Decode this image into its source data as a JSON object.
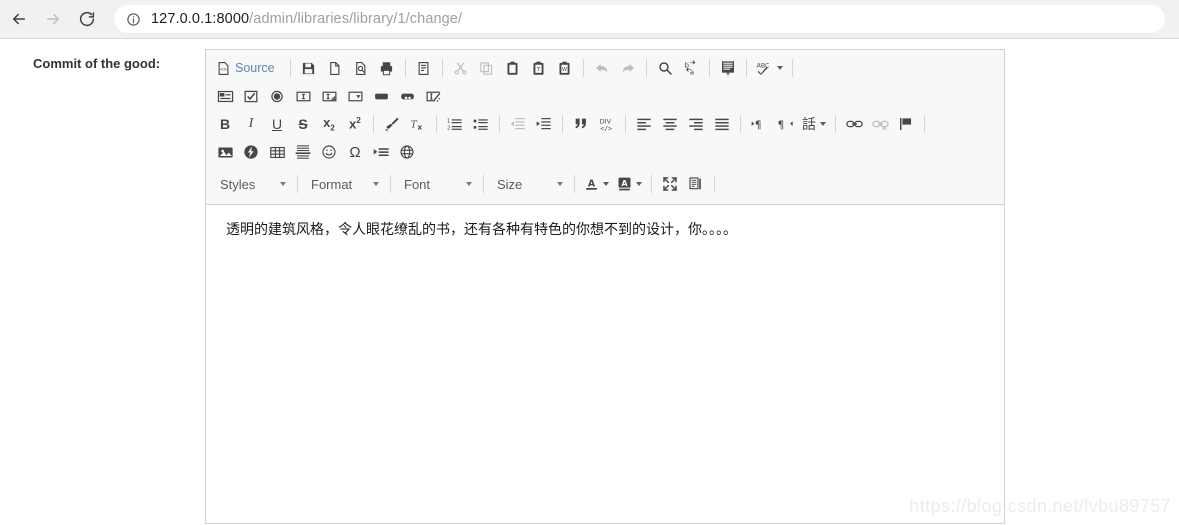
{
  "browser": {
    "back_icon": "back-arrow-icon",
    "forward_icon": "forward-arrow-icon",
    "reload_icon": "reload-icon",
    "info_icon": "site-info-icon",
    "url_host": "127.0.0.1:8000",
    "url_path": "/admin/libraries/library/1/change/",
    "url_full": "127.0.0.1:8000/admin/libraries/library/1/change/"
  },
  "form": {
    "field_label": "Commit of the good:"
  },
  "editor": {
    "source_label": "Source",
    "body_text": "透明的建筑风格，令人眼花缭乱的书，还有各种有特色的你想不到的设计，你。。。。",
    "toolbar_rows": [
      [
        {
          "name": "source-button",
          "label": "Source",
          "type": "text",
          "disabled": false
        },
        {
          "name": "separator",
          "type": "sep"
        },
        {
          "name": "save-button",
          "type": "icon",
          "disabled": false
        },
        {
          "name": "new-page-button",
          "type": "icon",
          "disabled": false
        },
        {
          "name": "preview-button",
          "type": "icon",
          "disabled": false
        },
        {
          "name": "print-button",
          "type": "icon",
          "disabled": false
        },
        {
          "name": "separator",
          "type": "sep"
        },
        {
          "name": "templates-button",
          "type": "icon",
          "disabled": false
        },
        {
          "name": "separator",
          "type": "sep"
        },
        {
          "name": "cut-button",
          "type": "icon",
          "disabled": true
        },
        {
          "name": "copy-button",
          "type": "icon",
          "disabled": true
        },
        {
          "name": "paste-button",
          "type": "icon",
          "disabled": false
        },
        {
          "name": "paste-as-text-button",
          "type": "icon",
          "disabled": false
        },
        {
          "name": "paste-from-word-button",
          "type": "icon",
          "disabled": false
        },
        {
          "name": "separator",
          "type": "sep"
        },
        {
          "name": "undo-button",
          "type": "icon",
          "disabled": true
        },
        {
          "name": "redo-button",
          "type": "icon",
          "disabled": true
        },
        {
          "name": "separator",
          "type": "sep"
        },
        {
          "name": "find-button",
          "type": "icon",
          "disabled": false
        },
        {
          "name": "replace-button",
          "type": "icon",
          "disabled": false
        },
        {
          "name": "separator",
          "type": "sep"
        },
        {
          "name": "select-all-button",
          "type": "icon",
          "disabled": false
        },
        {
          "name": "separator",
          "type": "sep"
        },
        {
          "name": "spell-check-button",
          "type": "icon",
          "disabled": false,
          "caret": true
        },
        {
          "name": "separator",
          "type": "sep"
        }
      ],
      [
        {
          "name": "form-button",
          "type": "icon"
        },
        {
          "name": "checkbox-button",
          "type": "icon"
        },
        {
          "name": "radio-button-button",
          "type": "icon"
        },
        {
          "name": "text-field-button",
          "type": "icon"
        },
        {
          "name": "textarea-button",
          "type": "icon"
        },
        {
          "name": "select-field-button",
          "type": "icon"
        },
        {
          "name": "button-button",
          "type": "icon"
        },
        {
          "name": "image-button-button",
          "type": "icon"
        },
        {
          "name": "hidden-field-button",
          "type": "icon"
        }
      ],
      [
        {
          "name": "bold-button",
          "label": "B",
          "type": "letter"
        },
        {
          "name": "italic-button",
          "label": "I",
          "type": "letter"
        },
        {
          "name": "underline-button",
          "label": "U",
          "type": "letter"
        },
        {
          "name": "strike-button",
          "label": "S",
          "type": "letter"
        },
        {
          "name": "subscript-button",
          "type": "icon"
        },
        {
          "name": "superscript-button",
          "type": "icon"
        },
        {
          "name": "separator",
          "type": "sep"
        },
        {
          "name": "remove-format-button",
          "type": "icon"
        },
        {
          "name": "copy-formatting-button",
          "type": "icon"
        },
        {
          "name": "separator",
          "type": "sep"
        },
        {
          "name": "numbered-list-button",
          "type": "icon"
        },
        {
          "name": "bulleted-list-button",
          "type": "icon"
        },
        {
          "name": "separator",
          "type": "sep"
        },
        {
          "name": "outdent-button",
          "type": "icon",
          "disabled": true
        },
        {
          "name": "indent-button",
          "type": "icon"
        },
        {
          "name": "separator",
          "type": "sep"
        },
        {
          "name": "blockquote-button",
          "type": "icon"
        },
        {
          "name": "div-container-button",
          "type": "icon"
        },
        {
          "name": "separator",
          "type": "sep"
        },
        {
          "name": "align-left-button",
          "type": "icon"
        },
        {
          "name": "align-center-button",
          "type": "icon"
        },
        {
          "name": "align-right-button",
          "type": "icon"
        },
        {
          "name": "justify-button",
          "type": "icon"
        },
        {
          "name": "separator",
          "type": "sep"
        },
        {
          "name": "ltr-button",
          "type": "icon"
        },
        {
          "name": "rtl-button",
          "type": "icon"
        },
        {
          "name": "language-button",
          "label": "話",
          "type": "letter",
          "caret": true
        },
        {
          "name": "separator",
          "type": "sep"
        },
        {
          "name": "link-button",
          "type": "icon"
        },
        {
          "name": "unlink-button",
          "type": "icon",
          "disabled": true
        },
        {
          "name": "anchor-button",
          "type": "icon"
        },
        {
          "name": "separator",
          "type": "sep"
        }
      ],
      [
        {
          "name": "image-button",
          "type": "icon"
        },
        {
          "name": "flash-button",
          "type": "icon"
        },
        {
          "name": "table-button",
          "type": "icon"
        },
        {
          "name": "horizontal-rule-button",
          "type": "icon"
        },
        {
          "name": "smiley-button",
          "type": "icon"
        },
        {
          "name": "special-character-button",
          "label": "Ω",
          "type": "letter"
        },
        {
          "name": "page-break-button",
          "type": "icon"
        },
        {
          "name": "iframe-button",
          "type": "icon"
        }
      ],
      [
        {
          "name": "styles-dropdown",
          "label": "Styles",
          "type": "combo"
        },
        {
          "name": "separator",
          "type": "sep"
        },
        {
          "name": "format-dropdown",
          "label": "Format",
          "type": "combo"
        },
        {
          "name": "separator",
          "type": "sep"
        },
        {
          "name": "font-dropdown",
          "label": "Font",
          "type": "combo"
        },
        {
          "name": "separator",
          "type": "sep"
        },
        {
          "name": "size-dropdown",
          "label": "Size",
          "type": "combo"
        },
        {
          "name": "separator",
          "type": "sep"
        },
        {
          "name": "text-color-button",
          "type": "icon",
          "caret": true
        },
        {
          "name": "background-color-button",
          "type": "icon",
          "caret": true
        },
        {
          "name": "separator",
          "type": "sep"
        },
        {
          "name": "maximize-button",
          "type": "icon"
        },
        {
          "name": "show-blocks-button",
          "type": "icon"
        },
        {
          "name": "separator",
          "type": "sep"
        },
        {
          "name": "about-button",
          "label": "?",
          "type": "letter"
        }
      ]
    ],
    "combo_labels": {
      "styles": "Styles",
      "format": "Format",
      "font": "Font",
      "size": "Size"
    }
  },
  "watermark": {
    "text": "https://blog.csdn.net/lvbu89757"
  },
  "colors": {
    "toolbar_bg": "#f8f8f8",
    "border": "#d1d1d1",
    "icon": "#474747",
    "source_link": "#5b87b5",
    "url_host": "#202124",
    "url_path": "#9aa0a6",
    "watermark": "#ececec"
  }
}
